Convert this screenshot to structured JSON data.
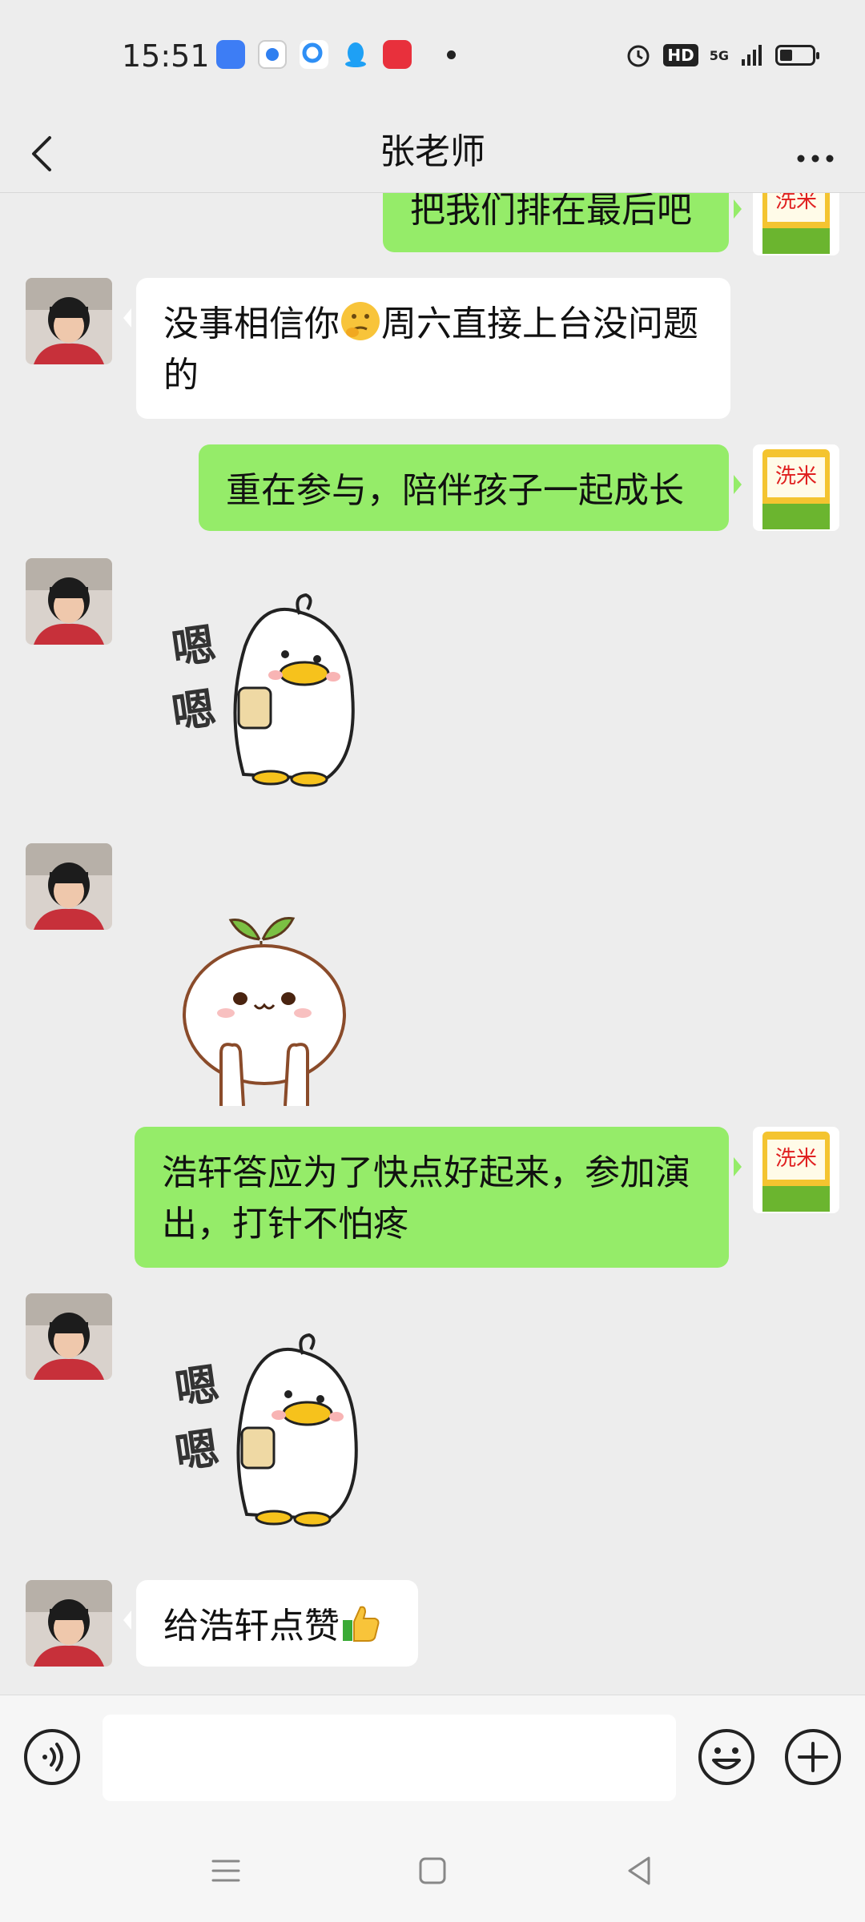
{
  "status_bar": {
    "time": "15:51",
    "network": "5G",
    "hd_badge": "HD",
    "battery_level_fraction": 0.4,
    "app_icons": [
      "multitask-app-icon",
      "browser-app-icon",
      "search-app-icon",
      "qq-penguin-icon",
      "gift-app-icon"
    ]
  },
  "header": {
    "title": "张老师",
    "back_icon": "chevron-left-icon",
    "more_icon": "more-dots-icon"
  },
  "messages": [
    {
      "side": "right",
      "type": "text",
      "text": "把我们排在最后吧"
    },
    {
      "side": "left",
      "type": "text",
      "text_before_emoji": "没事相信你",
      "emoji": "thinking-face-emoji",
      "text_after_emoji": "周六直接上台没问题的"
    },
    {
      "side": "right",
      "type": "text",
      "text": "重在参与，陪伴孩子一起成长"
    },
    {
      "side": "left",
      "type": "sticker",
      "sticker": "duck-with-cup-sticker",
      "sticker_text": "嗯嗯"
    },
    {
      "side": "left",
      "type": "sticker",
      "sticker": "sprout-bun-sticker"
    },
    {
      "side": "right",
      "type": "text",
      "text": "浩轩答应为了快点好起来，参加演出，打针不怕疼"
    },
    {
      "side": "left",
      "type": "sticker",
      "sticker": "duck-with-cup-sticker",
      "sticker_text": "嗯嗯"
    },
    {
      "side": "left",
      "type": "text",
      "text_before_emoji": "给浩轩点赞",
      "emoji": "thumbs-up-emoji"
    }
  ],
  "avatars": {
    "other": "child-photo-avatar",
    "self": "rice-bag-avatar",
    "self_avatar_text": "洗米"
  },
  "input_bar": {
    "voice_icon": "voice-icon",
    "input_value": "",
    "emoji_icon": "smiley-icon",
    "add_icon": "plus-circle-icon"
  },
  "nav_bar": {
    "icons": [
      "menu-icon",
      "home-square-icon",
      "back-triangle-icon"
    ]
  },
  "colors": {
    "background": "#ededed",
    "sent_bubble": "#95ec69",
    "received_bubble": "#ffffff"
  }
}
